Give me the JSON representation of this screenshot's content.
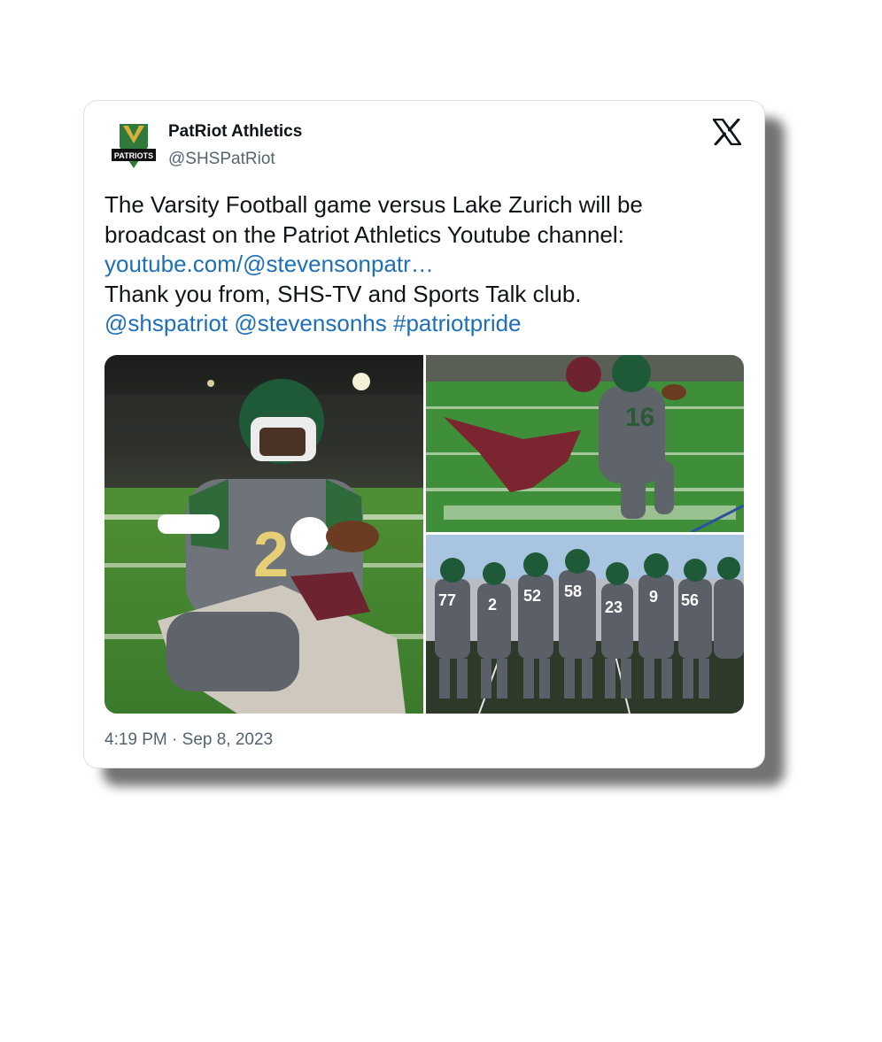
{
  "tweet": {
    "author_name": "PatRiot Athletics",
    "handle": "@SHSPatRiot",
    "avatar_logo_text": "PATRIOTS",
    "platform_icon": "x-logo-icon",
    "text_line_1": "The Varsity Football game versus Lake Zurich will be",
    "text_line_2": "broadcast on the Patriot Athletics Youtube channel:",
    "link": "youtube.com/@stevensonpatr…",
    "text_line_4": "Thank you from, SHS-TV and Sports Talk club.",
    "mention_1": "@shspatriot",
    "mention_2": "@stevensonhs",
    "hashtag": "#patriotpride",
    "timestamp": "4:19 PM · Sep 8, 2023"
  },
  "colors": {
    "link": "#1d6fb8",
    "secondary_text": "#536471",
    "jersey_gray": "#6f747b",
    "helmet_green": "#1f5a38",
    "field_green": "#3f8f3a"
  }
}
